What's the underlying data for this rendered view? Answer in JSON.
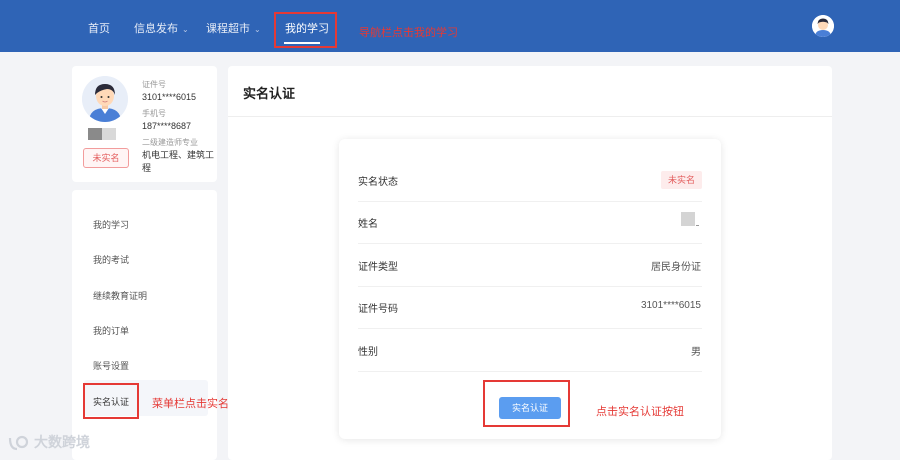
{
  "nav": {
    "items": [
      {
        "label": "首页",
        "has_dropdown": false
      },
      {
        "label": "信息发布",
        "has_dropdown": true
      },
      {
        "label": "课程超市",
        "has_dropdown": true
      },
      {
        "label": "我的学习",
        "has_dropdown": false,
        "active": true
      }
    ],
    "caret_glyph": "⌄",
    "annotation": "导航栏点击我的学习",
    "avatar_icon": "user-avatar-icon"
  },
  "profile": {
    "id_label": "证件号",
    "id_value": "3101****6015",
    "phone_label": "手机号",
    "phone_value": "187****8687",
    "cert_label": "二级建造师专业",
    "cert_value": "机电工程、建筑工程",
    "status_badge": "未实名"
  },
  "menu": {
    "items": [
      {
        "label": "我的学习"
      },
      {
        "label": "我的考试"
      },
      {
        "label": "继续教育证明"
      },
      {
        "label": "我的订单"
      },
      {
        "label": "账号设置"
      },
      {
        "label": "实名认证",
        "active": true
      }
    ],
    "annotation": "菜单栏点击实名认证"
  },
  "main": {
    "title": "实名认证",
    "rows": [
      {
        "label": "实名状态",
        "value": "未实名"
      },
      {
        "label": "姓名",
        "value": ""
      },
      {
        "label": "证件类型",
        "value": "居民身份证"
      },
      {
        "label": "证件号码",
        "value": "3101****6015"
      },
      {
        "label": "性别",
        "value": "男"
      }
    ],
    "button_label": "实名认证",
    "button_annotation": "点击实名认证按钮"
  },
  "watermark": "大数跨境",
  "colors": {
    "nav_bg": "#2f64b6",
    "annotation_red": "#e53935",
    "button_blue": "#5b9df0",
    "status_red": "#e35d5d"
  }
}
